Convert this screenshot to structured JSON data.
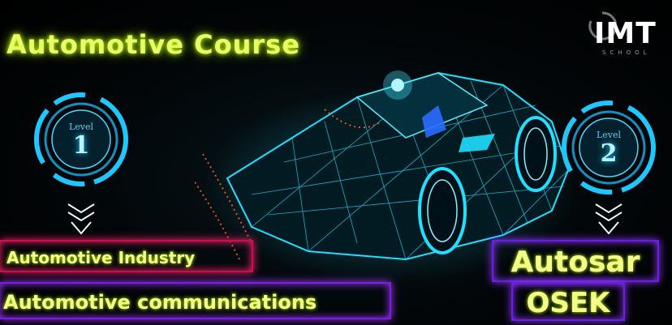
{
  "banner": {
    "title": "Automotive Course",
    "logo": {
      "text": "IMT",
      "subtext": "SCHOOL"
    },
    "levels": [
      {
        "word": "Level",
        "number": "1",
        "topics": [
          "Automotive Industry",
          "Automotive communications"
        ]
      },
      {
        "word": "Level",
        "number": "2",
        "topics": [
          "Autosar",
          "OSEK"
        ]
      }
    ],
    "colors": {
      "title_glow": "#c8ff00",
      "level_ring": "#1ec8ff",
      "box_red": "#ff1f6b",
      "box_purple": "#9a33ff",
      "car_wire": "#1ee0ff"
    }
  }
}
